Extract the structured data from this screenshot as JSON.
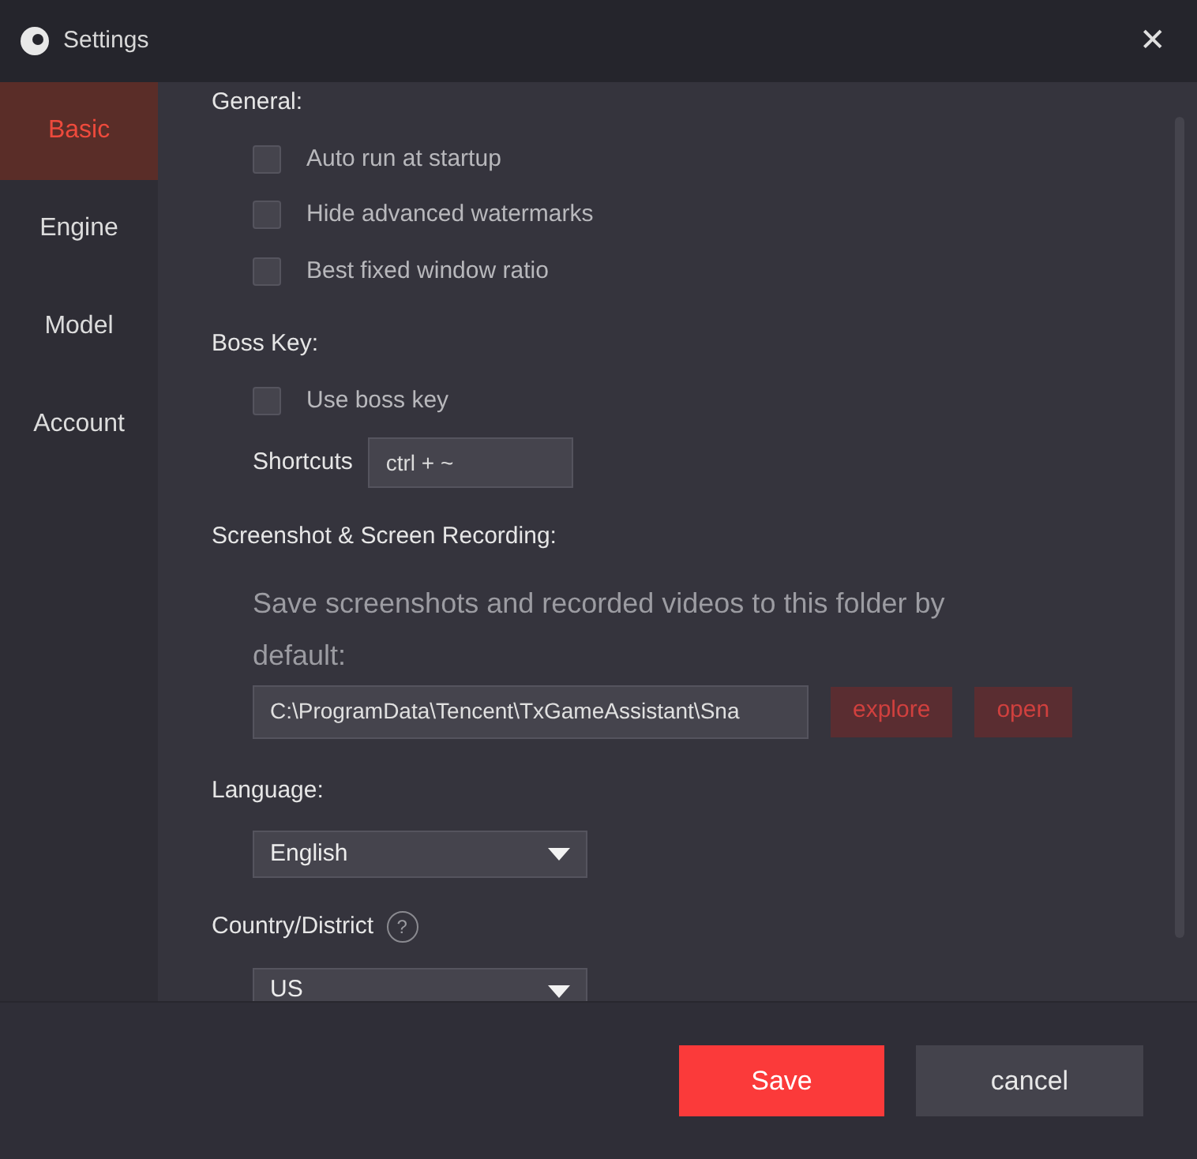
{
  "window": {
    "title": "Settings",
    "close": "✕"
  },
  "sidebar": {
    "items": [
      {
        "label": "Basic",
        "selected": true
      },
      {
        "label": "Engine",
        "selected": false
      },
      {
        "label": "Model",
        "selected": false
      },
      {
        "label": "Account",
        "selected": false
      }
    ]
  },
  "general": {
    "heading": "General:",
    "options": [
      {
        "label": "Auto run at startup",
        "checked": false
      },
      {
        "label": "Hide advanced watermarks",
        "checked": false
      },
      {
        "label": "Best fixed window ratio",
        "checked": false
      }
    ]
  },
  "boss_key": {
    "heading": "Boss Key:",
    "options": [
      {
        "label": "Use boss key",
        "checked": false
      }
    ],
    "shortcuts_label": "Shortcuts",
    "shortcuts_value": "ctrl + ~"
  },
  "screenshot": {
    "heading": "Screenshot & Screen Recording:",
    "description": "Save screenshots and recorded videos to this folder by default:",
    "path": "C:\\ProgramData\\Tencent\\TxGameAssistant\\Sna",
    "buttons": [
      "explore",
      "open"
    ]
  },
  "language": {
    "heading": "Language:",
    "value": "English"
  },
  "country": {
    "heading": "Country/District",
    "help": "?",
    "value": "US"
  },
  "footer": {
    "save": "Save",
    "cancel": "cancel"
  }
}
